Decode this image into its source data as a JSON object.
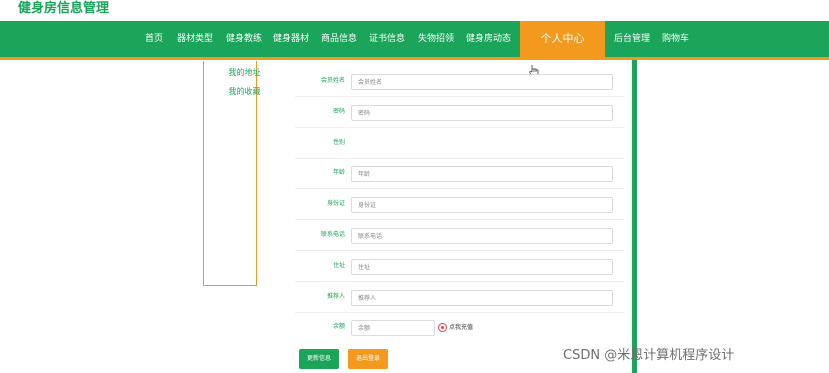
{
  "site": {
    "title": "健身房信息管理"
  },
  "nav": {
    "items": [
      {
        "label": "首页"
      },
      {
        "label": "器材类型"
      },
      {
        "label": "健身教练"
      },
      {
        "label": "健身器材"
      },
      {
        "label": "商品信息"
      },
      {
        "label": "证书信息"
      },
      {
        "label": "失物招领"
      },
      {
        "label": "健身房动态"
      },
      {
        "label": "个人中心"
      },
      {
        "label": "后台管理"
      },
      {
        "label": "购物车"
      }
    ],
    "active": "个人中心",
    "colors": {
      "bar": "#1aa55a",
      "active": "#f39a1e"
    }
  },
  "sidebar": {
    "items": [
      {
        "label": "我的地址"
      },
      {
        "label": "我的收藏"
      }
    ]
  },
  "form": {
    "fields": [
      {
        "label": "会员姓名",
        "placeholder": "会员姓名"
      },
      {
        "label": "密码",
        "placeholder": "密码"
      },
      {
        "label": "性别",
        "placeholder": ""
      },
      {
        "label": "年龄",
        "placeholder": "年龄"
      },
      {
        "label": "身份证",
        "placeholder": "身份证"
      },
      {
        "label": "联系电话",
        "placeholder": "联系电话"
      },
      {
        "label": "住址",
        "placeholder": "住址"
      },
      {
        "label": "推荐人",
        "placeholder": "推荐人"
      },
      {
        "label": "余额",
        "placeholder": "余额"
      }
    ],
    "recharge_label": "点我充值",
    "update_button": "更新信息",
    "logout_button": "退出登录"
  },
  "watermark": "CSDN @米恩计算机程序设计"
}
